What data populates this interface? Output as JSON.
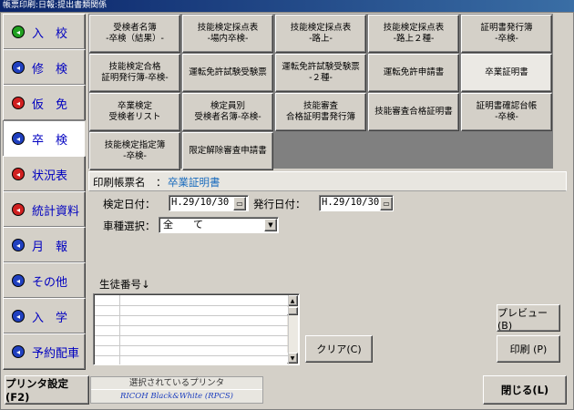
{
  "window": {
    "title": "帳票印刷:日報:提出書類関係"
  },
  "sidebar": {
    "items": [
      {
        "label": "入　校",
        "icon": "shield-green-icon",
        "color": "#20a020",
        "active": false
      },
      {
        "label": "修　検",
        "icon": "blue-circle-icon",
        "color": "#2040c0",
        "active": false
      },
      {
        "label": "仮　免",
        "icon": "target-circle-icon",
        "color": "#d02020",
        "active": false
      },
      {
        "label": "卒　検",
        "icon": "blue-circle-arrow-icon",
        "color": "#2040c0",
        "active": true
      },
      {
        "label": "状況表",
        "icon": "target-circle-icon",
        "color": "#d02020",
        "active": false
      },
      {
        "label": "統計資料",
        "icon": "heart-badge-icon",
        "color": "#d02020",
        "active": false
      },
      {
        "label": "月　報",
        "icon": "blue-circle-arrow-icon",
        "color": "#2040c0",
        "active": false
      },
      {
        "label": "その他",
        "icon": "blue-circle-arrow-icon",
        "color": "#2040c0",
        "active": false
      },
      {
        "label": "入　学",
        "icon": "blue-circle-arrow-icon",
        "color": "#2040c0",
        "active": false
      },
      {
        "label": "予約配車",
        "icon": "blue-circle-arrow-icon",
        "color": "#2040c0",
        "active": false
      }
    ]
  },
  "documents": [
    "受検者名簿\n-卒検（結果）-",
    "技能検定採点表\n-場内卒検-",
    "技能検定採点表\n-路上-",
    "技能検定採点表\n-路上２種-",
    "証明書発行簿\n-卒検-",
    "技能検定合格\n証明発行簿-卒検-",
    "運転免許試験受験票",
    "運転免許試験受験票\n-２種-",
    "運転免許申請書",
    "卒業証明書",
    "卒業検定\n受検者リスト",
    "検定員別\n受検者名簿-卒検-",
    "技能審査\n合格証明書発行簿",
    "技能審査合格証明書",
    "証明書確認台帳\n-卒検-",
    "技能検定指定簿\n-卒検-",
    "限定解除審査申請書"
  ],
  "selected_document_index": 9,
  "form": {
    "report_name_label": "印刷帳票名　：",
    "report_name_value": "卒業証明書",
    "exam_date_label": "検定日付：",
    "exam_date_value": "H.29/10/30",
    "issue_date_label": "発行日付：",
    "issue_date_value": "H.29/10/30",
    "vehicle_label": "車種選択：",
    "vehicle_value": "全　　て",
    "student_no_label": "生徒番号↓"
  },
  "buttons": {
    "clear": "クリア(C)",
    "preview": "プレビュー(B)",
    "print": "印刷 (P)",
    "printer_settings": "プリンタ設定(F2)",
    "close": "閉じる(L)"
  },
  "printer": {
    "header": "選択されているプリンタ",
    "name": "RICOH Black&White (RPCS)"
  }
}
